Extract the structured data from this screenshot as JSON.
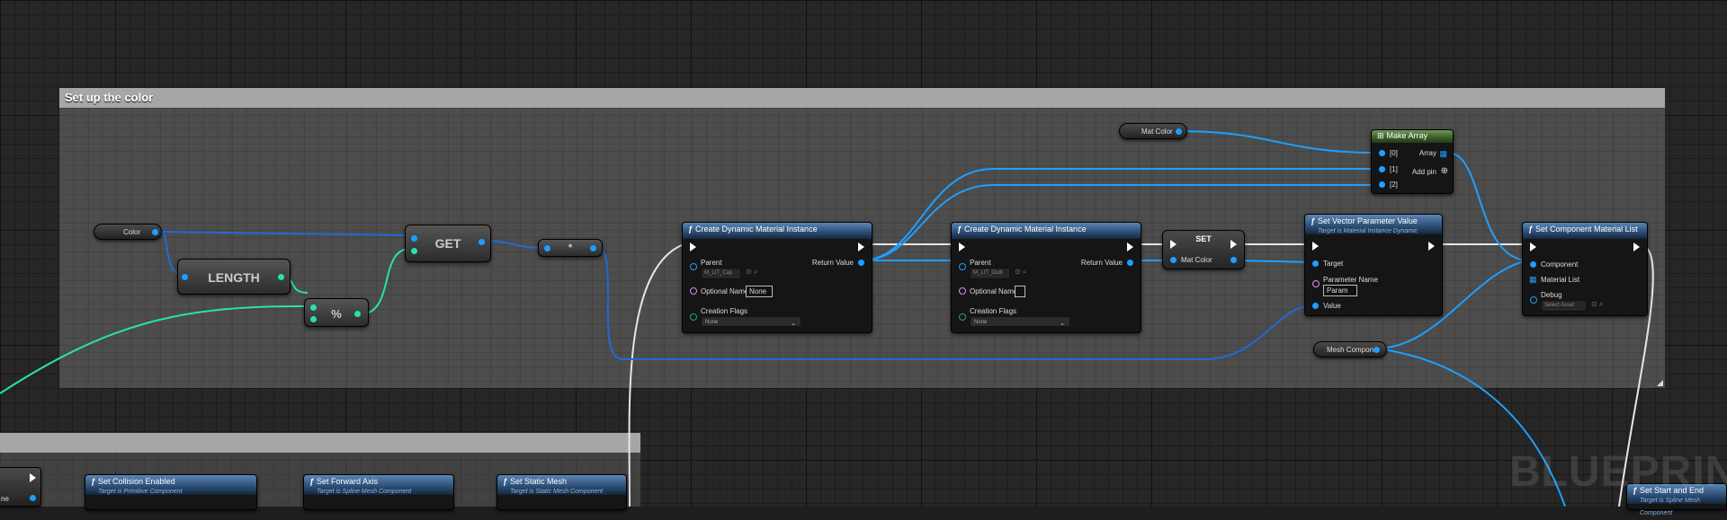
{
  "comment": {
    "title": "Set up the color"
  },
  "watermark": "BLUEPRINT",
  "vars": {
    "color": "Color",
    "mat_color": "Mat Color",
    "mesh_component": "Mesh Compone"
  },
  "ops": {
    "length": "LENGTH",
    "get": "GET",
    "modulo": "%",
    "multiply": "*",
    "set": "SET"
  },
  "cdmi1": {
    "title": "Create Dynamic Material Instance",
    "parent_label": "Parent",
    "parent_value": "M_LIT_Cap",
    "return_label": "Return Value",
    "optional_name_label": "Optional Name",
    "optional_name_value": "None",
    "creation_flags_label": "Creation Flags",
    "creation_flags_value": "None"
  },
  "cdmi2": {
    "title": "Create Dynamic Material Instance",
    "parent_label": "Parent",
    "parent_value": "M_LIT_Outli",
    "return_label": "Return Value",
    "optional_name_label": "Optional Name",
    "optional_name_value": "",
    "creation_flags_label": "Creation Flags",
    "creation_flags_value": "None"
  },
  "set_node": {
    "pin_label": "Mat Color"
  },
  "svpv": {
    "title": "Set Vector Parameter Value",
    "subtitle": "Target is Material Instance Dynamic",
    "target_label": "Target",
    "param_name_label": "Parameter Name",
    "param_name_value": "Param",
    "value_label": "Value"
  },
  "make_array": {
    "title": "Make Array",
    "pins": [
      "[0]",
      "[1]",
      "[2]"
    ],
    "array_label": "Array",
    "add_pin_label": "Add pin"
  },
  "scml": {
    "title": "Set Component Material List",
    "component_label": "Component",
    "material_list_label": "Material List",
    "debug_label": "Debug",
    "debug_value": "Select Asset"
  },
  "lower_nodes": [
    {
      "title": "Set Collision Enabled",
      "subtitle": "Target is Primitive Component"
    },
    {
      "title": "Set Forward Axis",
      "subtitle": "Target is Spline Mesh Component"
    },
    {
      "title": "Set Static Mesh",
      "subtitle": "Target is Static Mesh Component"
    },
    {
      "title": "Set Start and End",
      "subtitle": "Target is Spline Mesh Component"
    }
  ],
  "lower_left_pin": "ne",
  "colors": {
    "object_wire": "#1e9fff",
    "int_wire": "#28e0b0",
    "exec_wire": "#e6e6e6",
    "function_header": "#2a4c72",
    "make_array_header": "#3a5b2a"
  }
}
